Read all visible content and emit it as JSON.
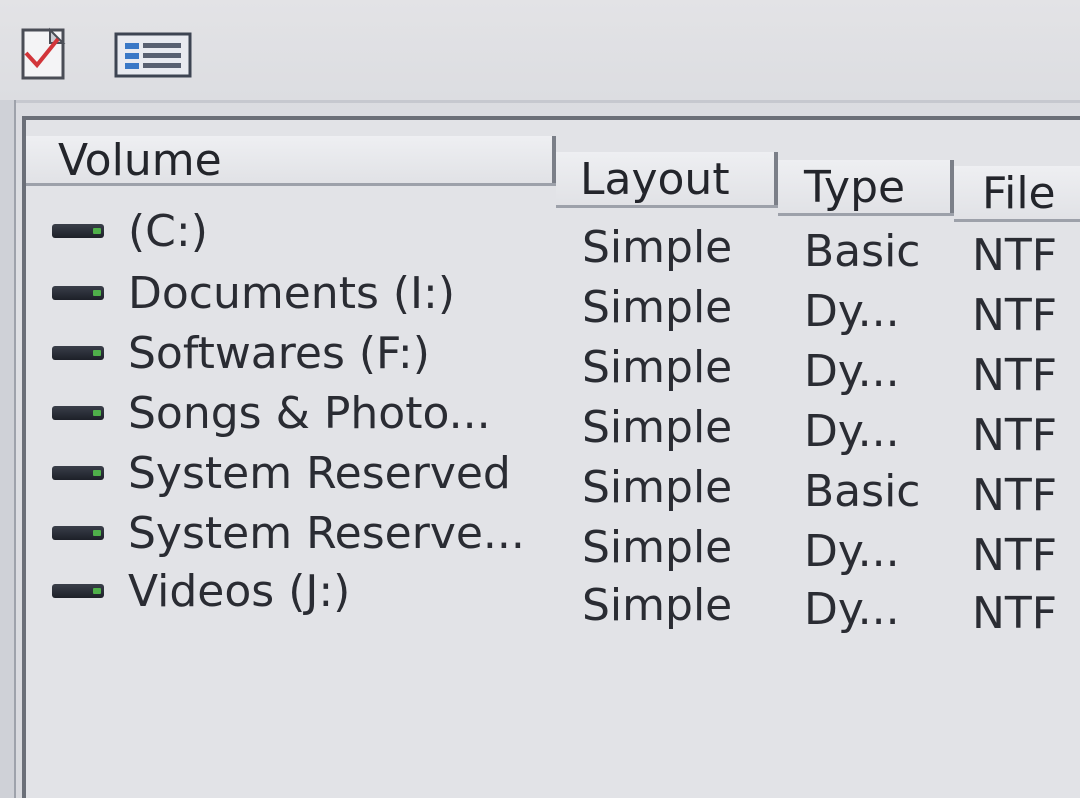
{
  "toolbar": {
    "buttons": [
      {
        "icon": "check-document-icon"
      },
      {
        "icon": "list-view-icon"
      }
    ]
  },
  "table": {
    "columns": {
      "volume": "Volume",
      "layout": "Layout",
      "type": "Type",
      "file_system": "File"
    },
    "rows": [
      {
        "name": " (C:)",
        "layout": "Simple",
        "type": "Basic",
        "fs": "NTF"
      },
      {
        "name": "Documents (I:)",
        "layout": "Simple",
        "type": "Dy...",
        "fs": "NTF"
      },
      {
        "name": "Softwares (F:)",
        "layout": "Simple",
        "type": "Dy...",
        "fs": "NTF"
      },
      {
        "name": "Songs & Photo...",
        "layout": "Simple",
        "type": "Dy...",
        "fs": "NTF"
      },
      {
        "name": "System Reserved",
        "layout": "Simple",
        "type": "Basic",
        "fs": "NTF"
      },
      {
        "name": "System Reserve...",
        "layout": "Simple",
        "type": "Dy...",
        "fs": "NTF"
      },
      {
        "name": "Videos (J:)",
        "layout": "Simple",
        "type": "Dy...",
        "fs": "NTF"
      }
    ]
  },
  "colors": {
    "background": "#dcdee3",
    "text": "#2a2c33",
    "header_separator": "#7b7f88",
    "drive_icon": "#1d2028",
    "drive_led": "#4fb04a"
  }
}
